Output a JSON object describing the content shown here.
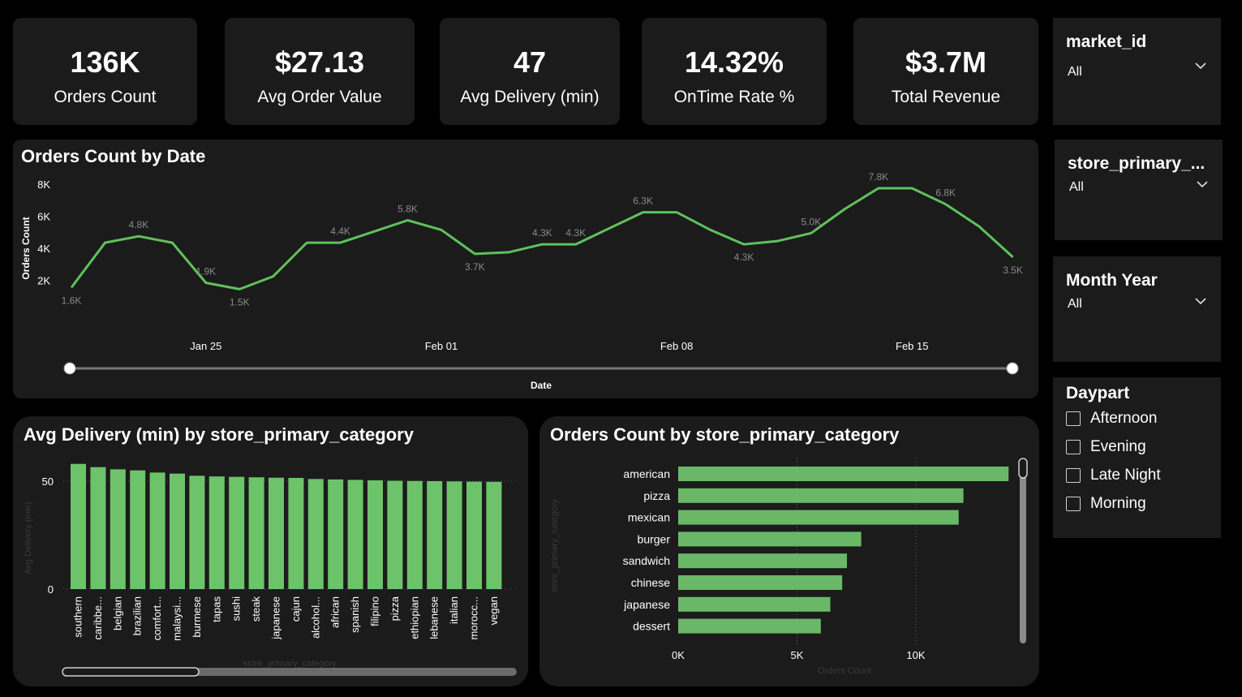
{
  "kpis": [
    {
      "value": "136K",
      "label": "Orders Count"
    },
    {
      "value": "$27.13",
      "label": "Avg Order Value"
    },
    {
      "value": "47",
      "label": "Avg Delivery (min)"
    },
    {
      "value": "14.32%",
      "label": "OnTime Rate %"
    },
    {
      "value": "$3.7M",
      "label": "Total Revenue"
    }
  ],
  "slicers": {
    "market_id": {
      "title": "market_id",
      "value": "All"
    },
    "store_primary": {
      "title": "store_primary_...",
      "value": "All"
    },
    "month_year": {
      "title": "Month Year",
      "value": "All"
    },
    "daypart": {
      "title": "Daypart",
      "options": [
        "Afternoon",
        "Evening",
        "Late Night",
        "Morning"
      ]
    }
  },
  "colors": {
    "accent": "#5fc15c",
    "bar": "#6cc36a",
    "panel": "#1b1b1b",
    "muted": "#8a8a8a"
  },
  "chart_data": [
    {
      "type": "line",
      "title": "Orders Count by Date",
      "xlabel": "Date",
      "ylabel": "Orders Count",
      "yticks": [
        "8K",
        "6K",
        "4K",
        "2K"
      ],
      "ylim": [
        0,
        8000
      ],
      "xtick_labels": [
        "Jan 25",
        "Feb 01",
        "Feb 08",
        "Feb 15"
      ],
      "x": [
        "Jan 22",
        "Jan 23",
        "Jan 24",
        "Jan 25",
        "Jan 26",
        "Jan 27",
        "Jan 28",
        "Jan 29",
        "Jan 30",
        "Jan 31",
        "Feb 01",
        "Feb 02",
        "Feb 03",
        "Feb 04",
        "Feb 05",
        "Feb 06",
        "Feb 07",
        "Feb 08",
        "Feb 09",
        "Feb 10",
        "Feb 11",
        "Feb 12",
        "Feb 13",
        "Feb 14",
        "Feb 15",
        "Feb 16",
        "Feb 17",
        "Feb 18"
      ],
      "values": [
        1600,
        4400,
        4800,
        4400,
        1900,
        1500,
        2300,
        4400,
        4400,
        5100,
        5800,
        5200,
        3700,
        3800,
        4300,
        4300,
        5300,
        6300,
        6300,
        5200,
        4300,
        4500,
        5000,
        6500,
        7800,
        7800,
        6800,
        5400,
        3500
      ],
      "point_labels": [
        {
          "i": 0,
          "text": "1.6K"
        },
        {
          "i": 2,
          "text": "4.8K"
        },
        {
          "i": 4,
          "text": "1.9K"
        },
        {
          "i": 5,
          "text": "1.5K"
        },
        {
          "i": 8,
          "text": "4.4K"
        },
        {
          "i": 10,
          "text": "5.8K"
        },
        {
          "i": 12,
          "text": "3.7K"
        },
        {
          "i": 14,
          "text": "4.3K"
        },
        {
          "i": 15,
          "text": "4.3K"
        },
        {
          "i": 17,
          "text": "6.3K"
        },
        {
          "i": 20,
          "text": "4.3K"
        },
        {
          "i": 22,
          "text": "5.0K"
        },
        {
          "i": 24,
          "text": "7.8K"
        },
        {
          "i": 26,
          "text": "6.8K"
        },
        {
          "i": 28,
          "text": "3.5K"
        }
      ]
    },
    {
      "type": "bar",
      "title": "Avg Delivery (min) by store_primary_category",
      "xlabel": "store_primary_category",
      "ylabel": "Avg Delivery (min)",
      "yticks": [
        "50",
        "0"
      ],
      "ylim": [
        0,
        50
      ],
      "categories": [
        "southern",
        "caribbe...",
        "belgian",
        "brazilian",
        "comfort...",
        "malaysi...",
        "burmese",
        "tapas",
        "sushi",
        "steak",
        "japanese",
        "cajun",
        "alcohol...",
        "african",
        "spanish",
        "filipino",
        "pizza",
        "ethiopian",
        "lebanese",
        "italian",
        "morocc...",
        "vegan"
      ],
      "values": [
        58,
        56.5,
        55.5,
        55,
        54,
        53.5,
        52.5,
        52.2,
        52,
        51.8,
        51.6,
        51.5,
        51,
        50.8,
        50.6,
        50.4,
        50.2,
        50.1,
        50,
        49.9,
        49.8,
        49.7
      ]
    },
    {
      "type": "bar",
      "orientation": "horizontal",
      "title": "Orders Count by store_primary_category",
      "xlabel": "Orders Count",
      "ylabel": "store_primary_category",
      "xticks": [
        "0K",
        "5K",
        "10K"
      ],
      "xlim": [
        0,
        14000
      ],
      "categories": [
        "american",
        "pizza",
        "mexican",
        "burger",
        "sandwich",
        "chinese",
        "japanese",
        "dessert"
      ],
      "values": [
        13900,
        12000,
        11800,
        7700,
        7100,
        6900,
        6400,
        6000
      ]
    }
  ]
}
